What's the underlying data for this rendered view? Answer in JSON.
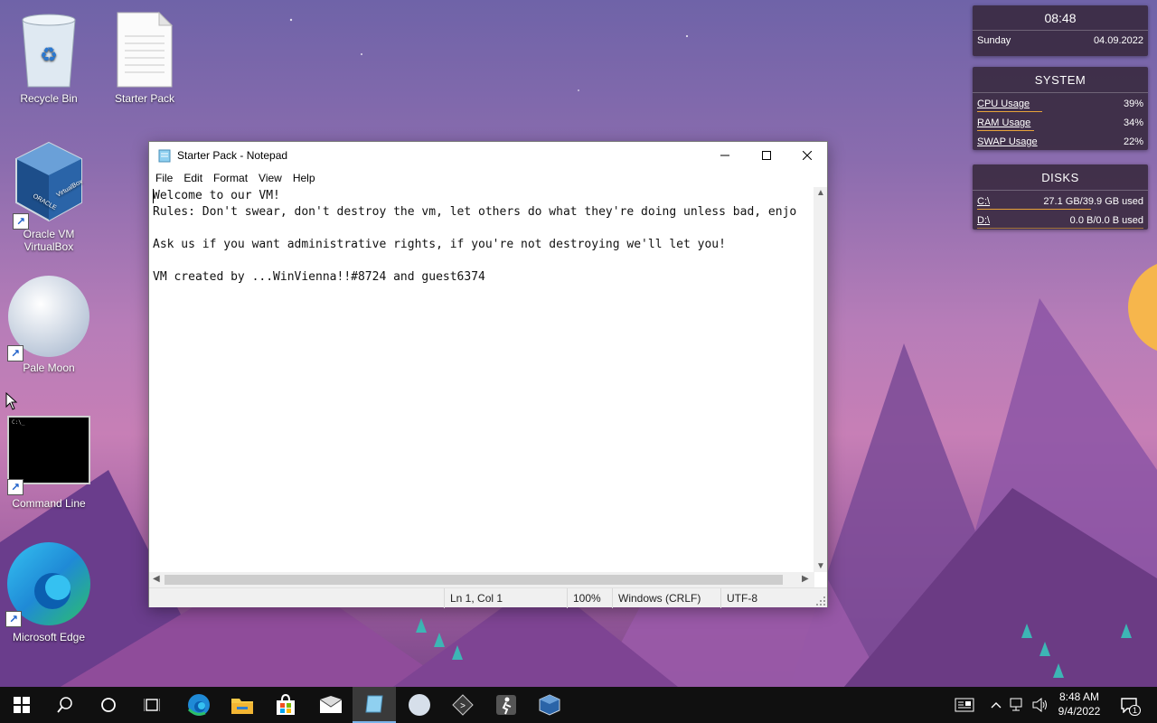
{
  "desktop": {
    "icons": [
      {
        "label": "Recycle Bin"
      },
      {
        "label": "Starter Pack"
      },
      {
        "label": "Oracle VM VirtualBox"
      },
      {
        "label": "Pale Moon"
      },
      {
        "label": "Command Line"
      },
      {
        "label": "Microsoft Edge"
      }
    ]
  },
  "widgets": {
    "clock": {
      "time": "08:48",
      "day": "Sunday",
      "date": "04.09.2022"
    },
    "system": {
      "title": "SYSTEM",
      "rows": [
        {
          "label": "CPU Usage",
          "value": "39%",
          "level": 0.39
        },
        {
          "label": "RAM Usage",
          "value": "34%",
          "level": 0.34
        },
        {
          "label": "SWAP Usage",
          "value": "22%",
          "level": 0.22
        }
      ]
    },
    "disks": {
      "title": "DISKS",
      "rows": [
        {
          "label": "C:\\",
          "value": "27.1 GB/39.9 GB used",
          "level": 0.68
        },
        {
          "label": "D:\\",
          "value": "0.0 B/0.0 B used",
          "level": 0.0
        }
      ]
    }
  },
  "notepad": {
    "title": "Starter Pack - Notepad",
    "menu": [
      "File",
      "Edit",
      "Format",
      "View",
      "Help"
    ],
    "content": "Welcome to our VM!\nRules: Don't swear, don't destroy the vm, let others do what they're doing unless bad, enjo\n\nAsk us if you want administrative rights, if you're not destroying we'll let you!\n\nVM created by ...WinVienna!!#8724 and guest6374",
    "status": {
      "position": "Ln 1, Col 1",
      "zoom": "100%",
      "line_ending": "Windows (CRLF)",
      "encoding": "UTF-8"
    }
  },
  "taskbar": {
    "clock_time": "8:48 AM",
    "clock_date": "9/4/2022",
    "notification_count": "1"
  },
  "colors": {
    "accent_orange": "#e8a33a",
    "taskbar_bg": "#101010",
    "edge_blue": "#1f8ad6"
  }
}
